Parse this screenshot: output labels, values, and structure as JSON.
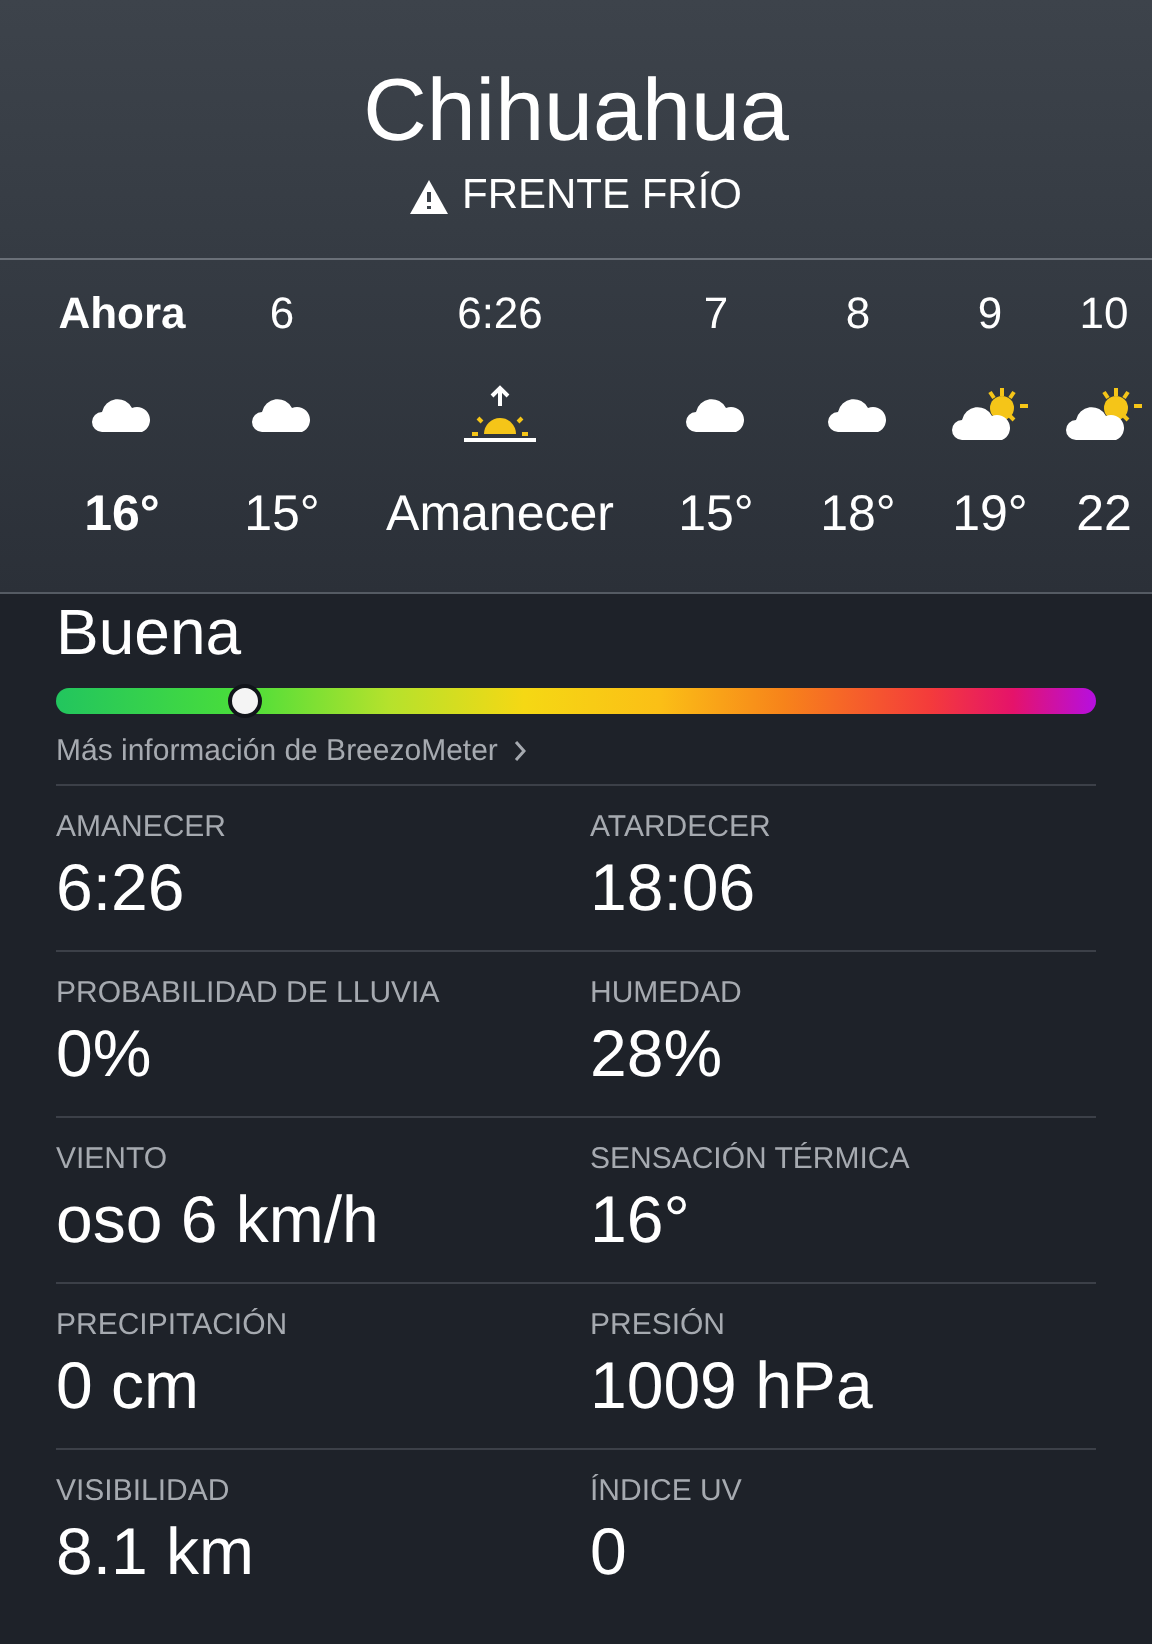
{
  "location": {
    "city": "Chihuahua",
    "alert": "FRENTE FRÍO"
  },
  "hourly": [
    {
      "time": "Ahora",
      "kind": "cloudy",
      "temp": "16°",
      "current": true
    },
    {
      "time": "6",
      "kind": "cloudy",
      "temp": "15°",
      "current": false
    },
    {
      "time": "6:26",
      "kind": "sunrise",
      "temp": "Amanecer",
      "current": false
    },
    {
      "time": "7",
      "kind": "cloudy",
      "temp": "15°",
      "current": false
    },
    {
      "time": "8",
      "kind": "cloudy",
      "temp": "18°",
      "current": false
    },
    {
      "time": "9",
      "kind": "partly_sunny",
      "temp": "19°",
      "current": false
    },
    {
      "time": "10",
      "kind": "partly_sunny",
      "temp": "22",
      "current": false
    }
  ],
  "air_quality": {
    "label": "Buena",
    "level": 0.18,
    "link": "Más información de BreezoMeter"
  },
  "details": [
    {
      "label": "AMANECER",
      "value": "6:26"
    },
    {
      "label": "ATARDECER",
      "value": "18:06"
    },
    {
      "label": "PROBABILIDAD DE LLUVIA",
      "value": "0%"
    },
    {
      "label": "HUMEDAD",
      "value": "28%"
    },
    {
      "label": "VIENTO",
      "value": "oso 6 km/h"
    },
    {
      "label": "SENSACIÓN TÉRMICA",
      "value": "16°"
    },
    {
      "label": "PRECIPITACIÓN",
      "value": "0 cm"
    },
    {
      "label": "PRESIÓN",
      "value": "1009 hPa"
    },
    {
      "label": "VISIBILIDAD",
      "value": "8.1 km"
    },
    {
      "label": "ÍNDICE UV",
      "value": "0"
    }
  ]
}
